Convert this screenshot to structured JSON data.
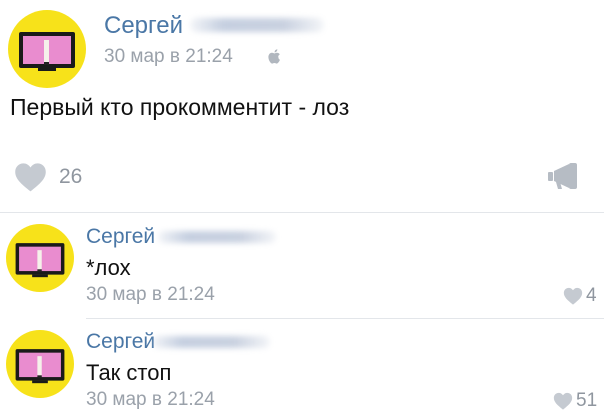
{
  "post": {
    "author": "Сергей",
    "time": "30 мар в 21:24",
    "device_icon": "apple-icon",
    "text": "Первый кто прокомментит - лоз",
    "likes": "26",
    "share_icon": "megaphone-icon"
  },
  "comments": [
    {
      "author": "Сергей",
      "text": "*лох",
      "time": "30 мар в 21:24",
      "likes": "4"
    },
    {
      "author": "Сергей",
      "text": "Так стоп",
      "time": "30 мар в 21:24",
      "likes": "51"
    }
  ],
  "colors": {
    "avatar_bg": "#f7e21a",
    "name": "#4a77a6",
    "meta": "#9aa1aa",
    "screen_pink": "#e98ccf"
  }
}
